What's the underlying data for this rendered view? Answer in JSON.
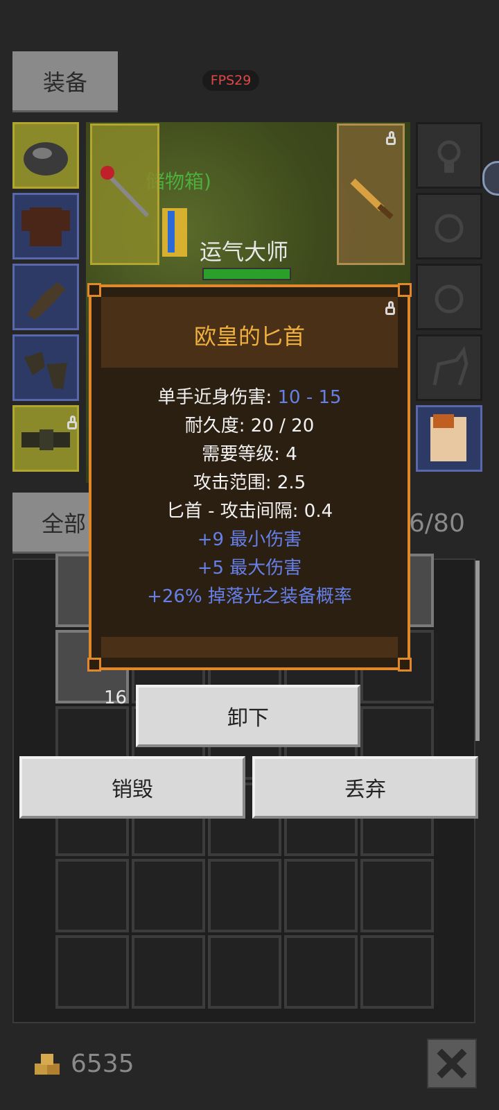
{
  "header": {
    "tab_equipment": "装备",
    "fps": "FPS29"
  },
  "scene": {
    "chest_label": "储物箱)",
    "player_name": "运气大师",
    "health_fraction": 1.0
  },
  "inventory": {
    "filter_label": "全部",
    "capacity": "6/80",
    "stack_count": "16"
  },
  "item_popup": {
    "title": "欧皇的匕首",
    "stats": [
      {
        "label": "单手近身伤害: ",
        "value": "10 - 15"
      },
      {
        "label": "耐久度: 20 / 20"
      },
      {
        "label": "需要等级: 4"
      },
      {
        "label": "攻击范围: 2.5"
      },
      {
        "label": "匕首 - 攻击间隔: 0.4"
      }
    ],
    "affixes": [
      "+9 最小伤害",
      "+5 最大伤害",
      "+26% 掉落光之装备概率"
    ]
  },
  "actions": {
    "unequip": "卸下",
    "destroy": "销毁",
    "discard": "丢弃"
  },
  "footer": {
    "gold": "6535"
  },
  "colors": {
    "accent_orange": "#e0882a",
    "affix_blue": "#6680e8",
    "title_gold": "#f0b040"
  },
  "icons": [
    "helmet-icon",
    "armor-icon",
    "glove-icon",
    "boots-icon",
    "belt-icon",
    "staff-icon",
    "dagger-icon",
    "amulet-icon",
    "ring-icon",
    "pet-icon",
    "scroll-icon",
    "lock-icon",
    "gold-icon",
    "close-icon"
  ]
}
